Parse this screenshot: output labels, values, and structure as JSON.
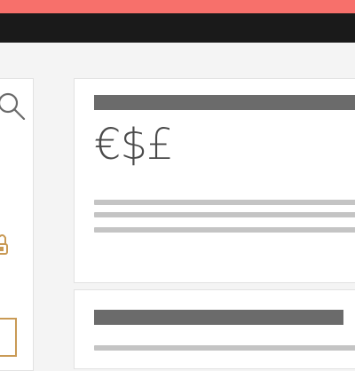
{
  "header": {
    "accent_color": "#f7706b",
    "bar_color": "#1a1a1a"
  },
  "sidebar": {
    "icons": [
      "search-icon",
      "lock-icon"
    ],
    "accent_box_color": "#c99a55"
  },
  "cards": [
    {
      "symbols": "€$£"
    },
    {}
  ]
}
